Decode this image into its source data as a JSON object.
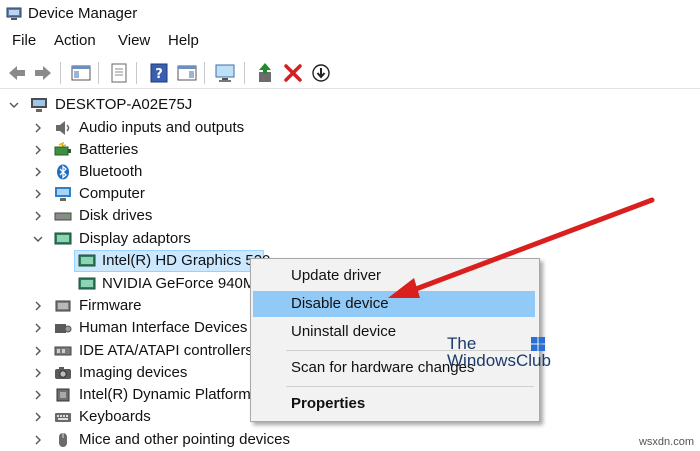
{
  "window": {
    "title": "Device Manager"
  },
  "menubar": {
    "items": [
      "File",
      "Action",
      "View",
      "Help"
    ]
  },
  "toolbar": {
    "buttons": [
      "back-icon",
      "forward-icon",
      "show-hide-tree-icon",
      "properties-icon",
      "help-icon",
      "action-pane-icon",
      "scan-monitor-icon",
      "update-driver-icon",
      "uninstall-x-icon",
      "disable-down-arrow-icon"
    ],
    "colors": {
      "uninstall": "#d32020",
      "update": "#1f8b2e"
    }
  },
  "tree": {
    "root": "DESKTOP-A02E75J",
    "categories": [
      {
        "label": "Audio inputs and outputs",
        "icon": "speaker-icon",
        "expanded": false
      },
      {
        "label": "Batteries",
        "icon": "battery-icon",
        "expanded": false
      },
      {
        "label": "Bluetooth",
        "icon": "bluetooth-icon",
        "expanded": false
      },
      {
        "label": "Computer",
        "icon": "computer-icon",
        "expanded": false
      },
      {
        "label": "Disk drives",
        "icon": "disk-drive-icon",
        "expanded": false
      },
      {
        "label": "Display adaptors",
        "icon": "display-adapter-icon",
        "expanded": true
      },
      {
        "label": "Intel(R) HD Graphics 520",
        "icon": "display-adapter-icon",
        "child": true,
        "selected": true
      },
      {
        "label": "NVIDIA GeForce 940MX",
        "icon": "display-adapter-icon",
        "child": true
      },
      {
        "label": "Firmware",
        "icon": "firmware-icon",
        "expanded": false
      },
      {
        "label": "Human Interface Devices",
        "icon": "hid-icon",
        "expanded": false
      },
      {
        "label": "IDE ATA/ATAPI controllers",
        "icon": "ide-controller-icon",
        "expanded": false
      },
      {
        "label": "Imaging devices",
        "icon": "camera-icon",
        "expanded": false
      },
      {
        "label": "Intel(R) Dynamic Platform and Thermal Framework",
        "icon": "chip-icon",
        "expanded": false
      },
      {
        "label": "Keyboards",
        "icon": "keyboard-icon",
        "expanded": false
      },
      {
        "label": "Mice and other pointing devices",
        "icon": "mouse-icon",
        "expanded": false
      }
    ]
  },
  "context_menu": {
    "items": [
      {
        "label": "Update driver"
      },
      {
        "label": "Disable device",
        "highlighted": true
      },
      {
        "label": "Uninstall device"
      },
      {
        "label": "Scan for hardware changes"
      },
      {
        "label": "Properties",
        "bold": true
      }
    ]
  },
  "watermark": {
    "line1": "The",
    "line2": "WindowsClub"
  },
  "credit": "wsxdn.com",
  "colors": {
    "arrow": "#d9201e",
    "menu_highlight": "#91c9f7",
    "selection": "#cce8ff"
  }
}
